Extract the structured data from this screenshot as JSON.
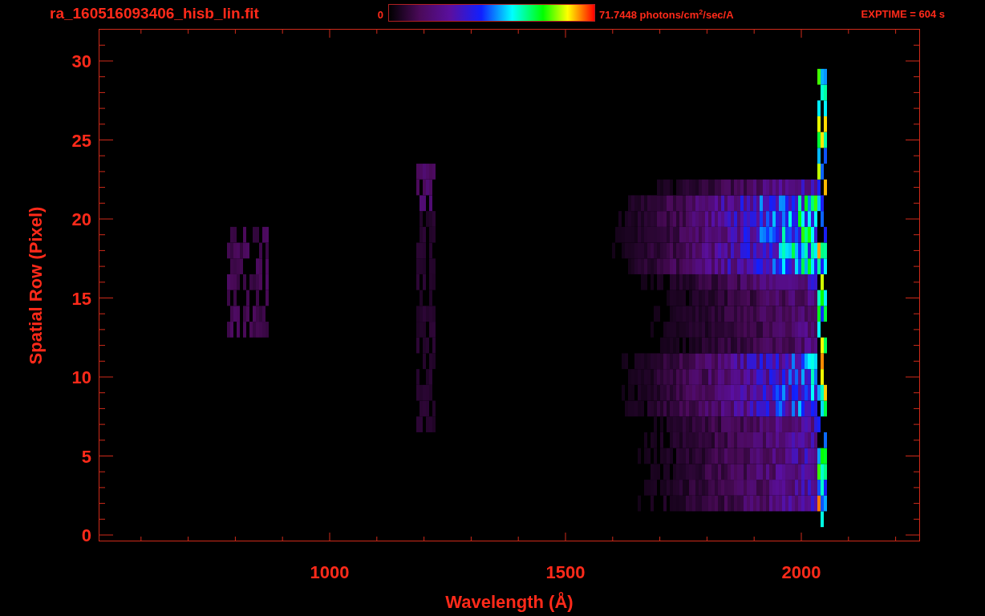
{
  "header": {
    "title": "ra_160516093406_hisb_lin.fit",
    "colorbar": {
      "min_label": "0",
      "max_label": "71.7448 photons/cm$^{2}$/sec/A"
    },
    "exptime": "EXPTIME = 604 s"
  },
  "plot": {
    "xlabel": "Wavelength (Å)",
    "ylabel": "Spatial Row (Pixel)",
    "xtick_labels": [
      "1000",
      "1500",
      "2000"
    ],
    "ytick_labels": [
      "30",
      "25",
      "20",
      "15",
      "10",
      "5",
      "0"
    ]
  }
}
